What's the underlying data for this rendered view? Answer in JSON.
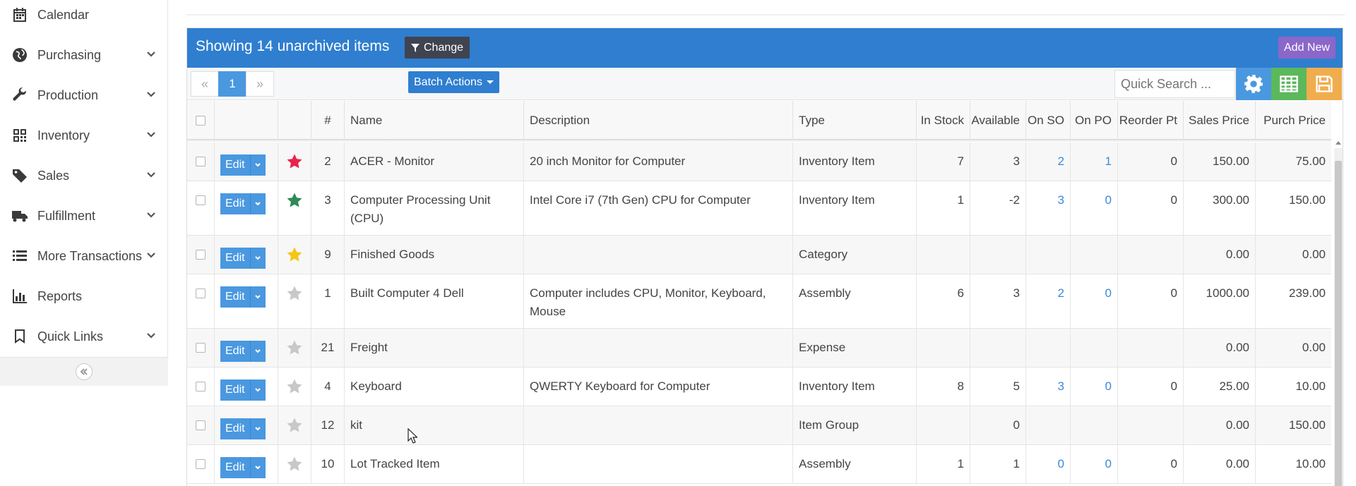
{
  "sidebar": {
    "items": [
      {
        "label": "Calendar",
        "icon": "calendar-icon",
        "has_chevron": false
      },
      {
        "label": "Purchasing",
        "icon": "globe-icon",
        "has_chevron": true
      },
      {
        "label": "Production",
        "icon": "wrench-icon",
        "has_chevron": true
      },
      {
        "label": "Inventory",
        "icon": "qrcode-icon",
        "has_chevron": true
      },
      {
        "label": "Sales",
        "icon": "tags-icon",
        "has_chevron": true
      },
      {
        "label": "Fulfillment",
        "icon": "truck-icon",
        "has_chevron": true
      },
      {
        "label": "More Transactions",
        "icon": "list-icon",
        "has_chevron": true
      },
      {
        "label": "Reports",
        "icon": "bar-chart-icon",
        "has_chevron": false
      },
      {
        "label": "Quick Links",
        "icon": "bookmark-icon",
        "has_chevron": true
      }
    ]
  },
  "panel": {
    "title": "Showing 14 unarchived items",
    "change_label": "Change",
    "add_new_label": "Add New"
  },
  "toolbar": {
    "prev": "«",
    "page": "1",
    "next": "»",
    "batch_actions_label": "Batch Actions",
    "search_placeholder": "Quick Search ..."
  },
  "table": {
    "headers": {
      "num": "#",
      "name": "Name",
      "description": "Description",
      "type": "Type",
      "in_stock": "In Stock",
      "available": "Available",
      "on_so": "On SO",
      "on_po": "On PO",
      "reorder_pt": "Reorder Pt",
      "sales_price": "Sales Price",
      "purch_price": "Purch Price"
    },
    "edit_label": "Edit",
    "colors": {
      "star_red": "#e8234a",
      "star_green": "#2e8b57",
      "star_yellow": "#f5c518",
      "star_gray": "#c8c8c8"
    },
    "rows": [
      {
        "num": "2",
        "name": "ACER - Monitor",
        "description": "20 inch Monitor for Computer",
        "type": "Inventory Item",
        "in_stock": "7",
        "available": "3",
        "on_so": "2",
        "on_po": "1",
        "reorder_pt": "0",
        "sales_price": "150.00",
        "purch_price": "75.00",
        "star": "red"
      },
      {
        "num": "3",
        "name": "Computer Processing Unit (CPU)",
        "description": "Intel Core i7 (7th Gen) CPU for Computer",
        "type": "Inventory Item",
        "in_stock": "1",
        "available": "-2",
        "on_so": "3",
        "on_po": "0",
        "reorder_pt": "0",
        "sales_price": "300.00",
        "purch_price": "150.00",
        "star": "green"
      },
      {
        "num": "9",
        "name": "Finished Goods",
        "description": "",
        "type": "Category",
        "in_stock": "",
        "available": "",
        "on_so": "",
        "on_po": "",
        "reorder_pt": "",
        "sales_price": "0.00",
        "purch_price": "0.00",
        "star": "yellow"
      },
      {
        "num": "1",
        "name": "Built Computer 4 Dell",
        "description": "Computer includes CPU, Monitor, Keyboard, Mouse",
        "type": "Assembly",
        "in_stock": "6",
        "available": "3",
        "on_so": "2",
        "on_po": "0",
        "reorder_pt": "0",
        "sales_price": "1000.00",
        "purch_price": "239.00",
        "star": "gray"
      },
      {
        "num": "21",
        "name": "Freight",
        "description": "",
        "type": "Expense",
        "in_stock": "",
        "available": "",
        "on_so": "",
        "on_po": "",
        "reorder_pt": "",
        "sales_price": "0.00",
        "purch_price": "0.00",
        "star": "gray"
      },
      {
        "num": "4",
        "name": "Keyboard",
        "description": "QWERTY Keyboard for Computer",
        "type": "Inventory Item",
        "in_stock": "8",
        "available": "5",
        "on_so": "3",
        "on_po": "0",
        "reorder_pt": "0",
        "sales_price": "25.00",
        "purch_price": "10.00",
        "star": "gray"
      },
      {
        "num": "12",
        "name": "kit",
        "description": "",
        "type": "Item Group",
        "in_stock": "",
        "available": "0",
        "on_so": "",
        "on_po": "",
        "reorder_pt": "",
        "sales_price": "0.00",
        "purch_price": "150.00",
        "star": "gray"
      },
      {
        "num": "10",
        "name": "Lot Tracked Item",
        "description": "",
        "type": "Assembly",
        "in_stock": "1",
        "available": "1",
        "on_so": "0",
        "on_po": "0",
        "reorder_pt": "0",
        "sales_price": "0.00",
        "purch_price": "10.00",
        "star": "gray"
      }
    ]
  }
}
